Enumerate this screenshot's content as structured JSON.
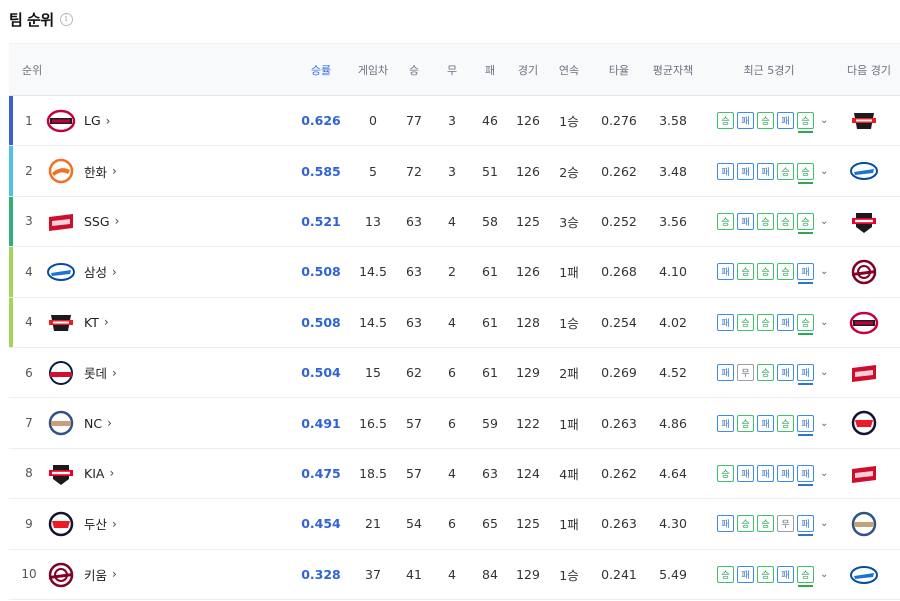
{
  "header": {
    "title": "팀 순위",
    "info_icon": "info-icon"
  },
  "columns": {
    "rank": "순위",
    "pct": "승률",
    "gb": "게임차",
    "w": "승",
    "d": "무",
    "l": "패",
    "g": "경기",
    "streak": "연속",
    "avg": "타율",
    "era": "평균자책",
    "recent": "최근 5경기",
    "next": "다음 경기"
  },
  "result_labels": {
    "W": "승",
    "L": "패",
    "D": "무"
  },
  "rows": [
    {
      "rank": "1",
      "team": "LG",
      "pct": "0.626",
      "gb": "0",
      "w": "77",
      "d": "3",
      "l": "46",
      "g": "126",
      "streak": "1승",
      "avg": "0.276",
      "era": "3.58",
      "recent": [
        "W",
        "L",
        "W",
        "L",
        "W"
      ],
      "bar": "#3b5fd0",
      "logo": "twins",
      "next": "ktwiz"
    },
    {
      "rank": "2",
      "team": "한화",
      "pct": "0.585",
      "gb": "5",
      "w": "72",
      "d": "3",
      "l": "51",
      "g": "126",
      "streak": "2승",
      "avg": "0.262",
      "era": "3.48",
      "recent": [
        "L",
        "L",
        "L",
        "W",
        "W"
      ],
      "bar": "#4cc3e0",
      "logo": "eagles",
      "next": "lions"
    },
    {
      "rank": "3",
      "team": "SSG",
      "pct": "0.521",
      "gb": "13",
      "w": "63",
      "d": "4",
      "l": "58",
      "g": "125",
      "streak": "3승",
      "avg": "0.252",
      "era": "3.56",
      "recent": [
        "W",
        "L",
        "W",
        "W",
        "W"
      ],
      "bar": "#2fb07a",
      "logo": "landers",
      "next": "tigers"
    },
    {
      "rank": "4",
      "team": "삼성",
      "pct": "0.508",
      "gb": "14.5",
      "w": "63",
      "d": "2",
      "l": "61",
      "g": "126",
      "streak": "1패",
      "avg": "0.268",
      "era": "4.10",
      "recent": [
        "L",
        "W",
        "W",
        "W",
        "L"
      ],
      "bar": "#a6d35a",
      "logo": "lions",
      "next": "heroes"
    },
    {
      "rank": "4",
      "team": "KT",
      "pct": "0.508",
      "gb": "14.5",
      "w": "63",
      "d": "4",
      "l": "61",
      "g": "128",
      "streak": "1승",
      "avg": "0.254",
      "era": "4.02",
      "recent": [
        "L",
        "W",
        "W",
        "L",
        "W"
      ],
      "bar": "#a6d35a",
      "logo": "ktwiz",
      "next": "twins"
    },
    {
      "rank": "6",
      "team": "롯데",
      "pct": "0.504",
      "gb": "15",
      "w": "62",
      "d": "6",
      "l": "61",
      "g": "129",
      "streak": "2패",
      "avg": "0.269",
      "era": "4.52",
      "recent": [
        "L",
        "D",
        "W",
        "L",
        "L"
      ],
      "bar": "",
      "logo": "giants",
      "next": "landers"
    },
    {
      "rank": "7",
      "team": "NC",
      "pct": "0.491",
      "gb": "16.5",
      "w": "57",
      "d": "6",
      "l": "59",
      "g": "122",
      "streak": "1패",
      "avg": "0.263",
      "era": "4.86",
      "recent": [
        "L",
        "W",
        "L",
        "W",
        "L"
      ],
      "bar": "",
      "logo": "dinos",
      "next": "bears"
    },
    {
      "rank": "8",
      "team": "KIA",
      "pct": "0.475",
      "gb": "18.5",
      "w": "57",
      "d": "4",
      "l": "63",
      "g": "124",
      "streak": "4패",
      "avg": "0.262",
      "era": "4.64",
      "recent": [
        "W",
        "L",
        "L",
        "L",
        "L"
      ],
      "bar": "",
      "logo": "tigers",
      "next": "landers"
    },
    {
      "rank": "9",
      "team": "두산",
      "pct": "0.454",
      "gb": "21",
      "w": "54",
      "d": "6",
      "l": "65",
      "g": "125",
      "streak": "1패",
      "avg": "0.263",
      "era": "4.30",
      "recent": [
        "L",
        "W",
        "W",
        "D",
        "L"
      ],
      "bar": "",
      "logo": "bears",
      "next": "dinos"
    },
    {
      "rank": "10",
      "team": "키움",
      "pct": "0.328",
      "gb": "37",
      "w": "41",
      "d": "4",
      "l": "84",
      "g": "129",
      "streak": "1승",
      "avg": "0.241",
      "era": "5.49",
      "recent": [
        "W",
        "L",
        "W",
        "L",
        "W"
      ],
      "bar": "",
      "logo": "heroes",
      "next": "lions"
    }
  ]
}
